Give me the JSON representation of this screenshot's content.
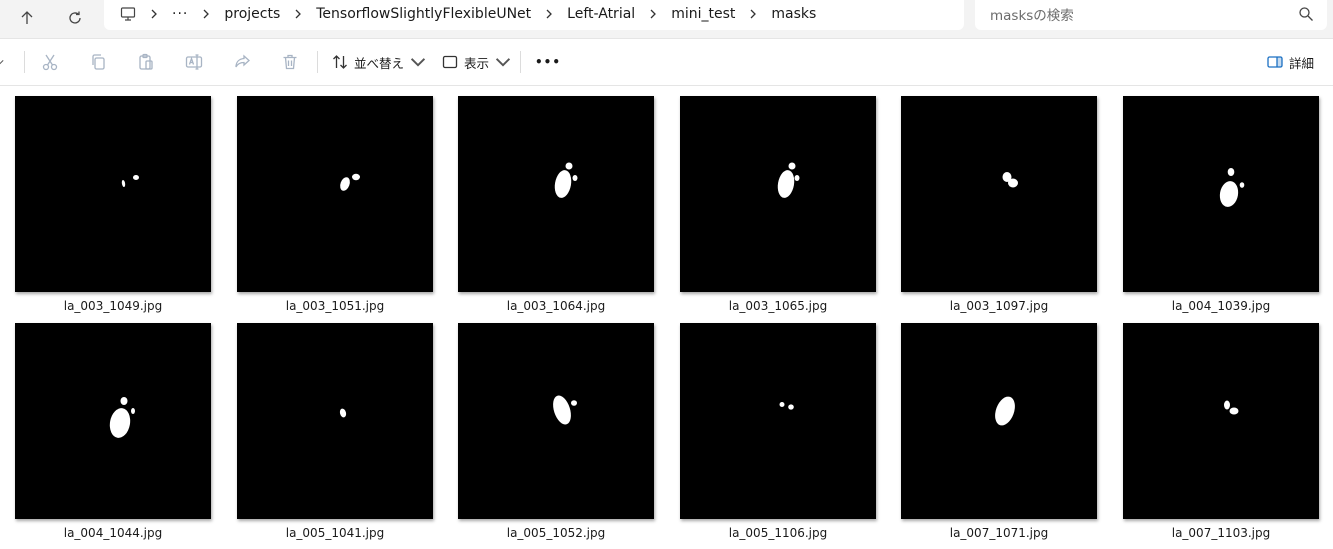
{
  "breadcrumb": [
    "projects",
    "TensorflowSlightlyFlexibleUNet",
    "Left-Atrial",
    "mini_test",
    "masks"
  ],
  "search": {
    "placeholder": "masksの検索"
  },
  "toolbar": {
    "sort_label": "並べ替え",
    "view_label": "表示",
    "more_label": "•••",
    "details_label": "詳細"
  },
  "icons": {
    "up": "up-arrow-icon",
    "refresh": "refresh-icon",
    "computer": "computer-icon",
    "cut": "cut-icon",
    "copy": "copy-icon",
    "paste": "paste-icon",
    "rename": "rename-icon",
    "share": "share-icon",
    "delete": "delete-icon",
    "sort": "sort-icon",
    "view": "view-icon",
    "details": "details-pane-icon",
    "search": "search-icon"
  },
  "colors": {
    "thumbnail_bg": "#000000",
    "mask": "#ffffff",
    "disabled_icon": "#a8b4c4"
  },
  "files": [
    {
      "name": "la_003_1049.jpg"
    },
    {
      "name": "la_003_1051.jpg"
    },
    {
      "name": "la_003_1064.jpg"
    },
    {
      "name": "la_003_1065.jpg"
    },
    {
      "name": "la_003_1097.jpg"
    },
    {
      "name": "la_004_1039.jpg"
    },
    {
      "name": "la_004_1044.jpg"
    },
    {
      "name": "la_005_1041.jpg"
    },
    {
      "name": "la_005_1052.jpg"
    },
    {
      "name": "la_005_1106.jpg"
    },
    {
      "name": "la_007_1071.jpg"
    },
    {
      "name": "la_007_1103.jpg"
    }
  ]
}
